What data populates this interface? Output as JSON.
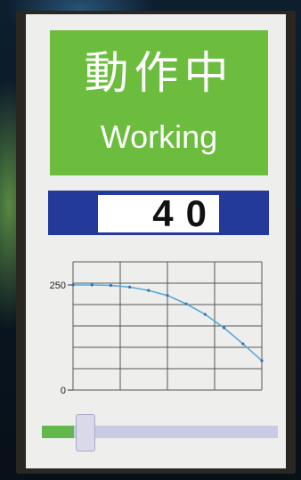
{
  "status": {
    "label_jp": "動作中",
    "label_en": "Working",
    "color": "#6cbc3e"
  },
  "value_display": {
    "value": "40",
    "bar_color": "#233a9a"
  },
  "chart_data": {
    "type": "line",
    "x": [
      0,
      1,
      2,
      3,
      4,
      5,
      6,
      7,
      8,
      9,
      10
    ],
    "series": [
      {
        "values": [
          250,
          250,
          249,
          245,
          237,
          225,
          205,
          180,
          148,
          110,
          70
        ]
      }
    ],
    "ylim": [
      0,
      250
    ],
    "xlim": [
      0,
      10
    ],
    "y_ticks": [
      "250",
      "0"
    ],
    "grid": true,
    "line_color": "#5aa9d6"
  },
  "slider": {
    "value_fraction": 0.18,
    "fill_color": "#62b84a",
    "track_color": "#c9cbe4"
  }
}
